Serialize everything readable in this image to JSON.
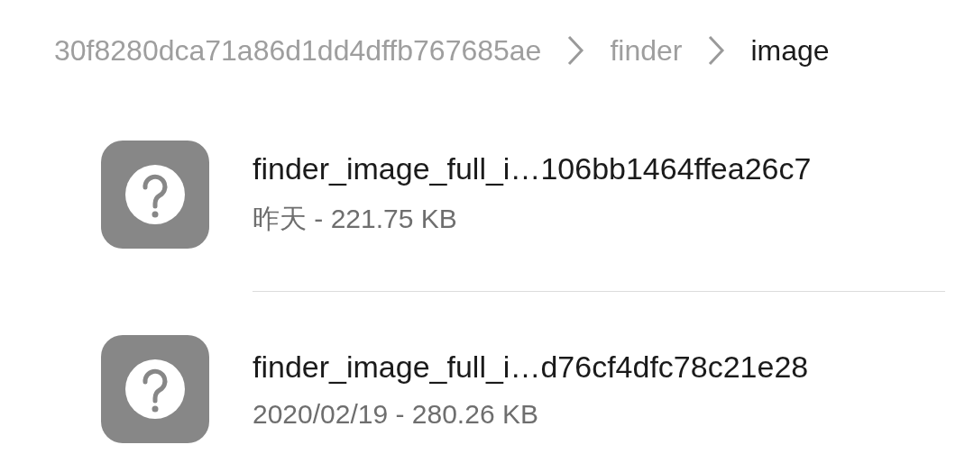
{
  "breadcrumb": [
    {
      "label": "30f8280dca71a86d1dd4dffb767685ae",
      "selected": false
    },
    {
      "label": "finder",
      "selected": false
    },
    {
      "label": "image",
      "selected": true
    }
  ],
  "files": [
    {
      "name": "finder_image_full_i…106bb1464ffea26c7",
      "meta": "昨天 - 221.75 KB"
    },
    {
      "name": "finder_image_full_i…d76cf4dfc78c21e28",
      "meta": "2020/02/19 - 280.26 KB"
    }
  ]
}
